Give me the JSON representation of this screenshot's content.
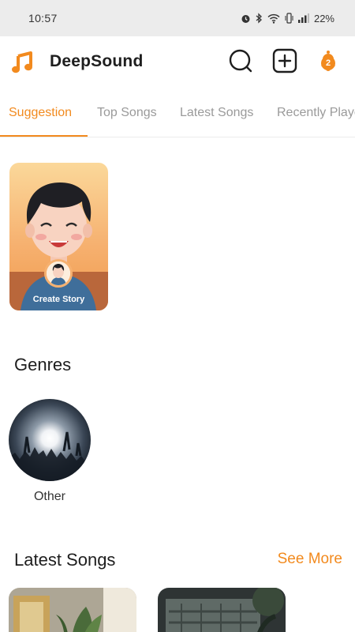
{
  "status_bar": {
    "time": "10:57",
    "battery": "22%",
    "icons": [
      "alarm-icon",
      "bluetooth-icon",
      "wifi-icon",
      "vibrate-icon",
      "signal-icon"
    ]
  },
  "app": {
    "title": "DeepSound",
    "accent_color": "#f28a1e",
    "notification_count": "2"
  },
  "tabs": [
    {
      "label": "Suggestion",
      "active": true
    },
    {
      "label": "Top Songs",
      "active": false
    },
    {
      "label": "Latest Songs",
      "active": false
    },
    {
      "label": "Recently Played",
      "active": false
    }
  ],
  "story": {
    "label": "Create Story"
  },
  "genres": {
    "title": "Genres",
    "items": [
      {
        "label": "Other"
      }
    ]
  },
  "latest_songs": {
    "title": "Latest Songs",
    "see_more": "See More"
  }
}
